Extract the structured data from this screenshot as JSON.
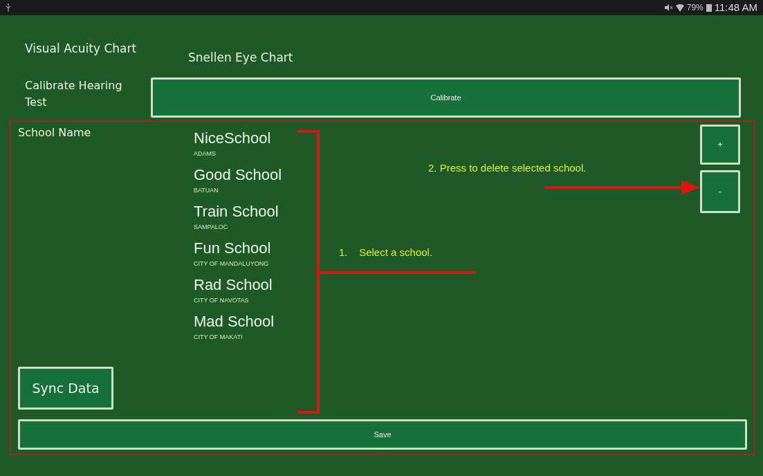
{
  "status_bar": {
    "battery": "79%",
    "time": "11:48 AM"
  },
  "visual_acuity": {
    "label": "Visual Acuity Chart",
    "value": "Snellen Eye Chart"
  },
  "calibrate": {
    "label": "Calibrate Hearing Test",
    "button": "Calibrate"
  },
  "school_name_label": "School Name",
  "schools": [
    {
      "name": "NiceSchool",
      "city": "ADAMS"
    },
    {
      "name": "Good School",
      "city": "BATUAN"
    },
    {
      "name": "Train School",
      "city": "SAMPALOC"
    },
    {
      "name": "Fun School",
      "city": "CITY OF MANDALUYONG"
    },
    {
      "name": "Rad School",
      "city": "CITY OF NAVOTAS"
    },
    {
      "name": "Mad School",
      "city": "CITY OF MAKATI"
    }
  ],
  "buttons": {
    "add": "+",
    "delete": "-",
    "sync": "Sync Data",
    "save": "Save"
  },
  "annotations": [
    {
      "text": "1.    Select a school."
    },
    {
      "text": "2. Press to delete selected school."
    }
  ]
}
